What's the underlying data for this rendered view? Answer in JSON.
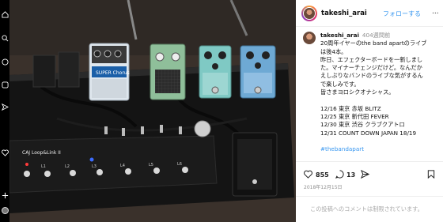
{
  "post": {
    "username": "takeshi_arai",
    "follow_label": "フォローする",
    "more_label": "...",
    "weeks_ago": "404週間前",
    "caption_lines": [
      "20周年イヤーのthe band apartのライブ",
      "は後4本。",
      "昨日、エフェクターボードを一新しまし",
      "た。マイナーチェンジだけど。なんだか",
      "えしぶりなバンドのライブな気がするん",
      "で楽しみです。",
      "皆さまヨロシクオナシャス。",
      "",
      "12/16 東京 赤坂 BLITZ",
      "12/25 東京 新代田 FEVER",
      "12/30 東京 渋谷 クラブクアトロ",
      "12/31 COUNT DOWN JAPAN 18/19",
      "",
      "#thebandapart"
    ],
    "likes": "855",
    "comments": "13",
    "date": "2018年12月15日",
    "comment_placeholder": "この投稿へのコメントは制限されています。"
  },
  "photo": {
    "pedal_labels": [
      "SUPER Chorus",
      "",
      "",
      ""
    ],
    "switcher_label": "CAJ Loop&Link II",
    "switcher_numbers": [
      "L1",
      "L2",
      "L3",
      "L4",
      "L5",
      "L6"
    ]
  },
  "colors": {
    "link": "#3897f0",
    "pedal_boss": "#dfe7ee",
    "pedal_green": "#8fbf9a",
    "pedal_teal": "#7fc9c4",
    "pedal_blue": "#6ea9d4"
  },
  "icons": [
    "home-icon",
    "search-icon",
    "explore-icon",
    "reels-icon",
    "messages-icon",
    "heart-icon",
    "create-icon",
    "profile-avatar",
    "comment-icon",
    "share-icon",
    "save-icon",
    "more-icon"
  ]
}
